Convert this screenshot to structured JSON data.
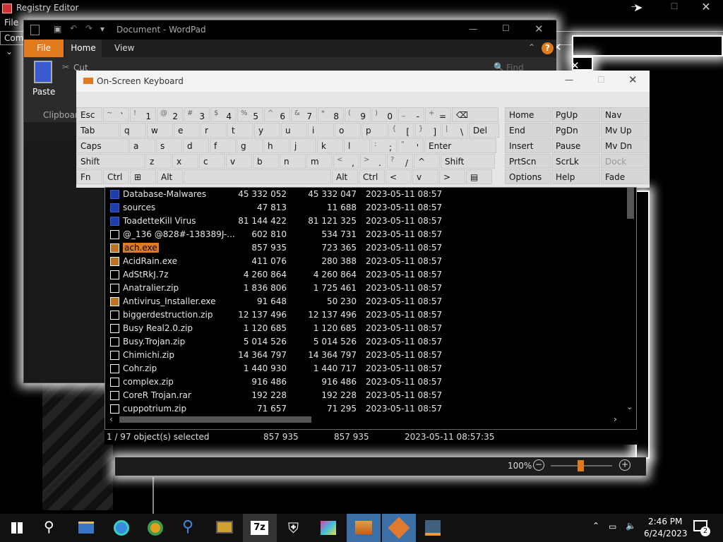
{
  "registry": {
    "title": "Registry Editor",
    "menu_file": "File",
    "address_fragment": "Com"
  },
  "wordpad": {
    "title": "Document - WordPad",
    "tabs": [
      "File",
      "Home",
      "View"
    ],
    "paste_label": "Paste",
    "cut_label": "Cut",
    "clipboard_label": "Clipboard",
    "find_label": "Find",
    "zoom": "100%"
  },
  "osk": {
    "title": "On-Screen Keyboard",
    "rows": [
      [
        {
          "l": "Esc"
        },
        {
          "s": "~",
          "m": "`"
        },
        {
          "s": "!",
          "m": "1"
        },
        {
          "s": "@",
          "m": "2"
        },
        {
          "s": "#",
          "m": "3"
        },
        {
          "s": "$",
          "m": "4"
        },
        {
          "s": "%",
          "m": "5"
        },
        {
          "s": "^",
          "m": "6"
        },
        {
          "s": "&",
          "m": "7"
        },
        {
          "s": "*",
          "m": "8"
        },
        {
          "s": "(",
          "m": "9"
        },
        {
          "s": ")",
          "m": "0"
        },
        {
          "s": "_",
          "m": "-"
        },
        {
          "s": "+",
          "m": "="
        },
        {
          "l": "⌫"
        }
      ],
      [
        {
          "l": "Tab"
        },
        {
          "l": "q"
        },
        {
          "l": "w"
        },
        {
          "l": "e"
        },
        {
          "l": "r"
        },
        {
          "l": "t"
        },
        {
          "l": "y"
        },
        {
          "l": "u"
        },
        {
          "l": "i"
        },
        {
          "l": "o"
        },
        {
          "l": "p"
        },
        {
          "s": "{",
          "m": "["
        },
        {
          "s": "}",
          "m": "]"
        },
        {
          "s": "|",
          "m": "\\"
        },
        {
          "l": "Del"
        }
      ],
      [
        {
          "l": "Caps"
        },
        {
          "l": "a"
        },
        {
          "l": "s"
        },
        {
          "l": "d"
        },
        {
          "l": "f"
        },
        {
          "l": "g"
        },
        {
          "l": "h"
        },
        {
          "l": "j"
        },
        {
          "l": "k"
        },
        {
          "l": "l"
        },
        {
          "s": ":",
          "m": ";"
        },
        {
          "s": "\"",
          "m": "'"
        },
        {
          "l": "Enter"
        }
      ],
      [
        {
          "l": "Shift"
        },
        {
          "l": "z"
        },
        {
          "l": "x"
        },
        {
          "l": "c"
        },
        {
          "l": "v"
        },
        {
          "l": "b"
        },
        {
          "l": "n"
        },
        {
          "l": "m"
        },
        {
          "s": "<",
          "m": ","
        },
        {
          "s": ">",
          "m": "."
        },
        {
          "s": "?",
          "m": "/"
        },
        {
          "l": "^"
        },
        {
          "l": "Shift"
        }
      ],
      [
        {
          "l": "Fn"
        },
        {
          "l": "Ctrl"
        },
        {
          "l": "⊞"
        },
        {
          "l": "Alt"
        },
        {
          "l": ""
        },
        {
          "l": "Alt"
        },
        {
          "l": "Ctrl"
        },
        {
          "l": "<"
        },
        {
          "l": "v"
        },
        {
          "l": ">"
        },
        {
          "l": "▤"
        }
      ]
    ],
    "nav": [
      [
        "Home",
        "PgUp",
        "Nav"
      ],
      [
        "End",
        "PgDn",
        "Mv Up"
      ],
      [
        "Insert",
        "Pause",
        "Mv Dn"
      ],
      [
        "PrtScn",
        "ScrLk",
        "Dock"
      ],
      [
        "Options",
        "Help",
        "Fade"
      ]
    ]
  },
  "files": [
    {
      "name": "Database-Malwares",
      "size": "45 332 052",
      "packed": "45 332 047",
      "date": "2023-05-11 08:57",
      "type": "folder"
    },
    {
      "name": "sources",
      "size": "47 813",
      "packed": "11 688",
      "date": "2023-05-11 08:57",
      "type": "folder"
    },
    {
      "name": "ToadetteKill Virus",
      "size": "81 144 422",
      "packed": "81 121 325",
      "date": "2023-05-11 08:57",
      "type": "folder"
    },
    {
      "name": "@_136 @828#-138389J-...",
      "size": "602 810",
      "packed": "534 731",
      "date": "2023-05-11 08:57",
      "type": "zip"
    },
    {
      "name": "ach.exe",
      "size": "857 935",
      "packed": "723 365",
      "date": "2023-05-11 08:57",
      "type": "exe"
    },
    {
      "name": "AcidRain.exe",
      "size": "411 076",
      "packed": "280 388",
      "date": "2023-05-11 08:57",
      "type": "exe"
    },
    {
      "name": "AdStRkJ.7z",
      "size": "4 260 864",
      "packed": "4 260 864",
      "date": "2023-05-11 08:57",
      "type": "zip"
    },
    {
      "name": "Anatralier.zip",
      "size": "1 836 806",
      "packed": "1 725 461",
      "date": "2023-05-11 08:57",
      "type": "zip"
    },
    {
      "name": "Antivirus_Installer.exe",
      "size": "91 648",
      "packed": "50 230",
      "date": "2023-05-11 08:57",
      "type": "exe"
    },
    {
      "name": "biggerdestruction.zip",
      "size": "12 137 496",
      "packed": "12 137 496",
      "date": "2023-05-11 08:57",
      "type": "zip"
    },
    {
      "name": "Busy Real2.0.zip",
      "size": "1 120 685",
      "packed": "1 120 685",
      "date": "2023-05-11 08:57",
      "type": "zip"
    },
    {
      "name": "Busy.Trojan.zip",
      "size": "5 014 526",
      "packed": "5 014 526",
      "date": "2023-05-11 08:57",
      "type": "zip"
    },
    {
      "name": "Chimichi.zip",
      "size": "14 364 797",
      "packed": "14 364 797",
      "date": "2023-05-11 08:57",
      "type": "zip"
    },
    {
      "name": "Cohr.zip",
      "size": "1 440 930",
      "packed": "1 440 717",
      "date": "2023-05-11 08:57",
      "type": "zip"
    },
    {
      "name": "complex.zip",
      "size": "916 486",
      "packed": "916 486",
      "date": "2023-05-11 08:57",
      "type": "zip"
    },
    {
      "name": "CoreR Trojan.rar",
      "size": "192 228",
      "packed": "192 228",
      "date": "2023-05-11 08:57",
      "type": "rar"
    },
    {
      "name": "cuppotrium.zip",
      "size": "71 657",
      "packed": "71 295",
      "date": "2023-05-11 08:57",
      "type": "zip"
    }
  ],
  "fm_status": {
    "selected": "1 / 97 object(s) selected",
    "size": "857 935",
    "packed": "857 935",
    "date": "2023-05-11 08:57:35"
  },
  "taskbar": {
    "time": "2:46 PM",
    "date": "6/24/2023",
    "notification_count": "2",
    "sevenzip_label": "7z"
  }
}
